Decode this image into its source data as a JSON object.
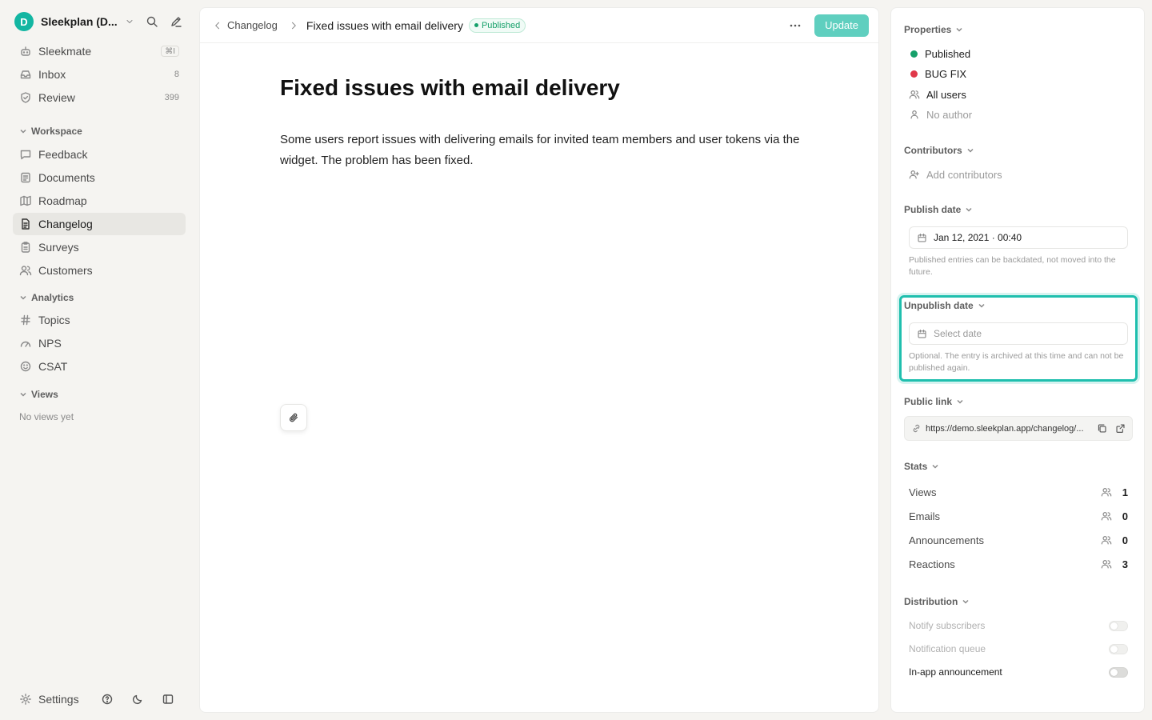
{
  "sidebar": {
    "workspace_initial": "D",
    "workspace_name": "Sleekplan (D...",
    "top_items": [
      {
        "label": "Sleekmate",
        "shortcut": "⌘I"
      },
      {
        "label": "Inbox",
        "badge": "8"
      },
      {
        "label": "Review",
        "badge": "399"
      }
    ],
    "workspace_section": "Workspace",
    "workspace_items": [
      {
        "label": "Feedback"
      },
      {
        "label": "Documents"
      },
      {
        "label": "Roadmap"
      },
      {
        "label": "Changelog"
      },
      {
        "label": "Surveys"
      },
      {
        "label": "Customers"
      }
    ],
    "analytics_section": "Analytics",
    "analytics_items": [
      {
        "label": "Topics"
      },
      {
        "label": "NPS"
      },
      {
        "label": "CSAT"
      }
    ],
    "views_section": "Views",
    "views_empty": "No views yet",
    "settings_label": "Settings"
  },
  "topbar": {
    "breadcrumb_parent": "Changelog",
    "breadcrumb_current": "Fixed issues with email delivery",
    "status_badge": "Published",
    "update_label": "Update"
  },
  "document": {
    "title": "Fixed issues with email delivery",
    "body": "Some users report issues with delivering emails for invited team members and user tokens via the widget. The problem has been fixed."
  },
  "properties": {
    "label": "Properties",
    "status": "Published",
    "category": "BUG FIX",
    "audience": "All users",
    "author": "No author",
    "status_color": "#16a06a",
    "category_color": "#e0384a"
  },
  "contributors": {
    "label": "Contributors",
    "add_label": "Add contributors"
  },
  "publish_date": {
    "label": "Publish date",
    "value": "Jan 12, 2021 · 00:40",
    "hint": "Published entries can be backdated, not moved into the future."
  },
  "unpublish_date": {
    "label": "Unpublish date",
    "placeholder": "Select date",
    "hint": "Optional. The entry is archived at this time and can not be published again."
  },
  "public_link": {
    "label": "Public link",
    "url": "https://demo.sleekplan.app/changelog/..."
  },
  "stats": {
    "label": "Stats",
    "items": [
      {
        "label": "Views",
        "value": "1"
      },
      {
        "label": "Emails",
        "value": "0"
      },
      {
        "label": "Announcements",
        "value": "0"
      },
      {
        "label": "Reactions",
        "value": "3"
      }
    ]
  },
  "distribution": {
    "label": "Distribution",
    "items": [
      {
        "label": "Notify subscribers",
        "enabled": false
      },
      {
        "label": "Notification queue",
        "enabled": false
      },
      {
        "label": "In-app announcement",
        "enabled": true
      }
    ]
  },
  "colors": {
    "accent": "#13b6a2",
    "update_button": "#5fcfbf",
    "highlight_border": "#1fbfae"
  }
}
